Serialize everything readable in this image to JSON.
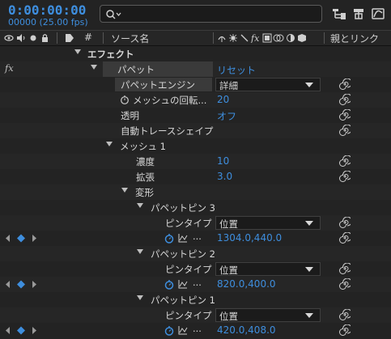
{
  "header": {
    "timecode": "0:00:00:00",
    "frame_info": "00000 (25.00 fps)",
    "search_placeholder": "",
    "accent_color": "#3e8ede"
  },
  "columns": {
    "av_switches_icons": [
      "eye-icon",
      "speaker-icon",
      "solo-icon",
      "lock-icon"
    ],
    "label_icon": "label-tag-icon",
    "number_label": "#",
    "source_name_label": "ソース名",
    "switches_icons": [
      "shy-icon",
      "collapse-icon",
      "quality-icon",
      "fx-icon",
      "motion-blur-icon",
      "adjustment-icon",
      "3d-icon"
    ],
    "parent_label": "親とリンク"
  },
  "rows": {
    "effects": "エフェクト",
    "fx_badge": "fx",
    "puppet": "パペット",
    "reset": "リセット",
    "puppet_engine": "パペットエンジン",
    "puppet_engine_value": "詳細",
    "mesh_rotation": "メッシュの回転...",
    "mesh_rotation_value": "20",
    "transparency": "透明",
    "transparency_value": "オフ",
    "auto_trace": "自動トレースシェイプ",
    "mesh1": "メッシュ 1",
    "density": "濃度",
    "density_value": "10",
    "expansion": "拡張",
    "expansion_value": "3.0",
    "deform": "変形",
    "pin3": "パペットピン 3",
    "pin_type": "ピンタイプ",
    "pin_type_value": "位置",
    "pin3_pos": "1304.0,440.0",
    "pin2": "パペットピン 2",
    "pin2_pos": "820.0,400.0",
    "pin1": "パペットピン 1",
    "pin1_pos": "420.0,408.0",
    "ellipsis": "..."
  }
}
